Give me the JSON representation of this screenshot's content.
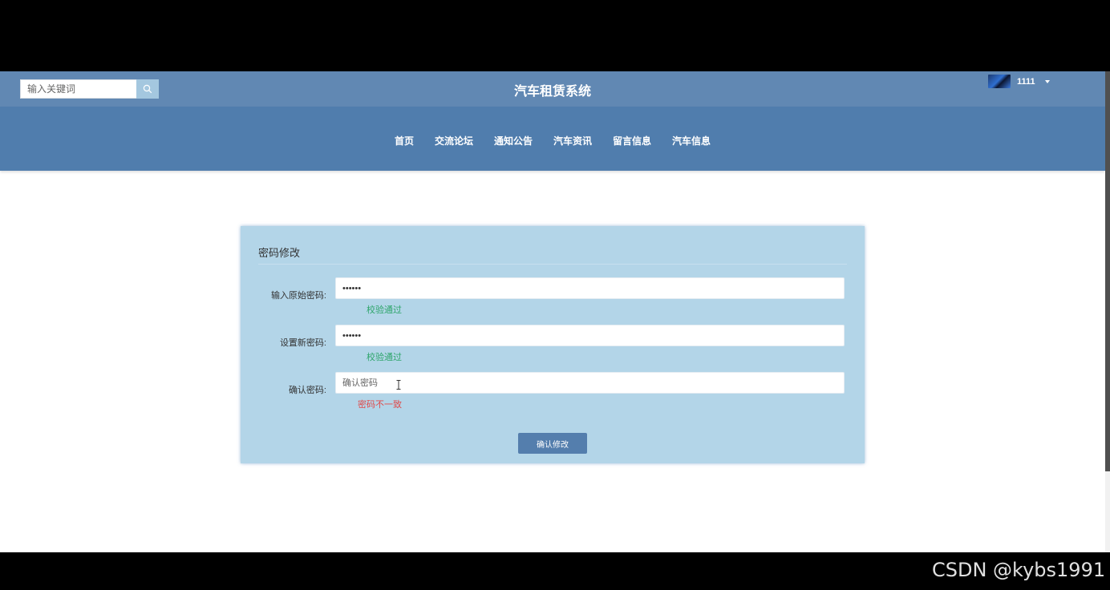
{
  "header": {
    "search_placeholder": "输入关键词",
    "site_title": "汽车租赁系统",
    "username": "1111"
  },
  "nav": {
    "items": [
      "首页",
      "交流论坛",
      "通知公告",
      "汽车资讯",
      "留言信息",
      "汽车信息"
    ]
  },
  "form": {
    "title": "密码修改",
    "old_password": {
      "label": "输入原始密码:",
      "value": "••••••",
      "hint": "校验通过"
    },
    "new_password": {
      "label": "设置新密码:",
      "value": "••••••",
      "hint": "校验通过"
    },
    "confirm_password": {
      "label": "确认密码:",
      "placeholder": "确认密码",
      "value": "",
      "hint": "密码不一致"
    },
    "submit_label": "确认修改"
  },
  "watermark": "CSDN @kybs1991",
  "colors": {
    "topbar": "#6188b3",
    "navbar": "#507dad",
    "panel": "#b3d5e8",
    "ok": "#2ea56b",
    "error": "#e04a4a",
    "button": "#547ead"
  },
  "icons": {
    "search": "search-icon",
    "user_menu": "caret-down-icon"
  }
}
